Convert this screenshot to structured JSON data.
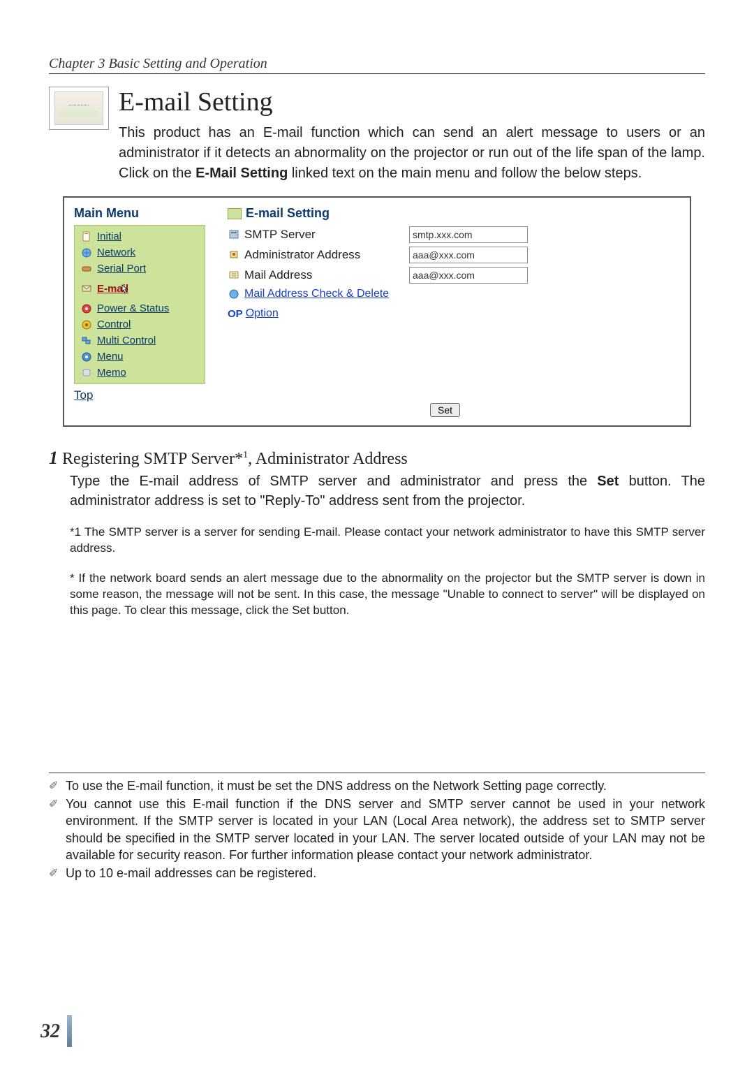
{
  "chapter": "Chapter 3 Basic Setting and Operation",
  "title": "E-mail Setting",
  "intro_part1": "This product has an E-mail function which can send an alert message to users or an administrator if it detects an abnormality on the projector or run out of the life span of the lamp. Click on the ",
  "intro_bold": "E-Mail Setting",
  "intro_part2": " linked text on the main menu and follow the below steps.",
  "menu": {
    "title": "Main Menu",
    "items": [
      {
        "label": "Initial"
      },
      {
        "label": "Network"
      },
      {
        "label": "Serial Port"
      },
      {
        "label": "E-mail"
      },
      {
        "label": "Power & Status"
      },
      {
        "label": "Control"
      },
      {
        "label": "Multi Control"
      },
      {
        "label": "Menu"
      },
      {
        "label": "Memo"
      }
    ],
    "top": "Top"
  },
  "panel": {
    "title": "E-mail Setting",
    "smtp_label": "SMTP Server",
    "smtp_value": "smtp.xxx.com",
    "admin_label": "Administrator Address",
    "admin_value": "aaa@xxx.com",
    "mail_label": "Mail Address",
    "mail_value": "aaa@xxx.com",
    "check_delete": "Mail Address Check & Delete",
    "op_badge": "OP",
    "option": "Option",
    "set": "Set"
  },
  "step": {
    "num": "1",
    "heading_a": " Registering SMTP Server*",
    "heading_sup": "1",
    "heading_b": ", Administrator Address",
    "body_a": "Type the E-mail address of SMTP server and administrator and press the ",
    "body_bold": "Set",
    "body_b": " button. The administrator address is set to \"Reply-To\" address sent from the projector."
  },
  "note1": "*1 The SMTP server is a server for sending E-mail. Please contact your network administrator to have this SMTP server address.",
  "note2_a": "* If the network board sends an alert message due to the abnormality on the projector but the SMTP server is down in some reason, the message will not be sent. In this case, the message \"Unable to connect to server\" will be displayed on this page. To clear this message, click the ",
  "note2_bold": "Set",
  "note2_b": " button.",
  "foot1": "To use the E-mail function, it must be set the DNS address on the Network Setting page correctly.",
  "foot2": "You cannot use this E-mail function if the DNS server and SMTP server cannot be used in your network environment. If the SMTP server is located in your LAN (Local Area network), the address set to SMTP server should be specified in the SMTP server located in your LAN. The server located outside of your LAN may not be available for security reason. For further information please contact your network administrator.",
  "foot3": "Up to 10 e-mail addresses can be registered.",
  "page_number": "32"
}
